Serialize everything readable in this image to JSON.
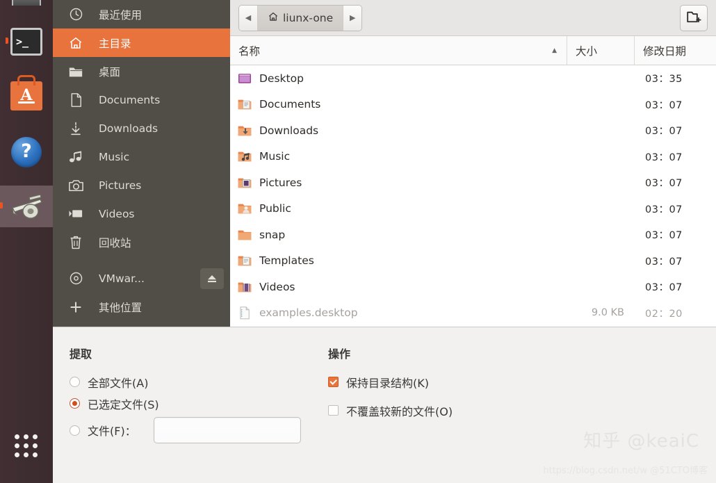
{
  "dock": {
    "items": [
      {
        "name": "partial-window-icon",
        "label": ""
      },
      {
        "name": "terminal",
        "label": "Terminal",
        "glyph": ">_",
        "running": true
      },
      {
        "name": "ubuntu-software",
        "label": "Ubuntu Software",
        "glyph": "A",
        "running": false
      },
      {
        "name": "help",
        "label": "Help",
        "glyph": "?",
        "running": false
      },
      {
        "name": "archive-manager",
        "label": "Archive Manager",
        "glyph": "",
        "running": true,
        "active": true
      },
      {
        "name": "show-applications",
        "label": "Show Applications",
        "glyph": "",
        "running": false
      }
    ]
  },
  "sidebar": {
    "items": [
      {
        "label": "最近使用",
        "icon": "clock-icon",
        "selected": false,
        "eject": false
      },
      {
        "label": "主目录",
        "icon": "home-icon",
        "selected": true,
        "eject": false
      },
      {
        "label": "桌面",
        "icon": "folder-icon",
        "selected": false,
        "eject": false
      },
      {
        "label": "Documents",
        "icon": "document-icon",
        "selected": false,
        "eject": false
      },
      {
        "label": "Downloads",
        "icon": "download-icon",
        "selected": false,
        "eject": false
      },
      {
        "label": "Music",
        "icon": "music-icon",
        "selected": false,
        "eject": false
      },
      {
        "label": "Pictures",
        "icon": "camera-icon",
        "selected": false,
        "eject": false
      },
      {
        "label": "Videos",
        "icon": "video-icon",
        "selected": false,
        "eject": false
      },
      {
        "label": "回收站",
        "icon": "trash-icon",
        "selected": false,
        "eject": false
      },
      {
        "label": "VMwar...",
        "icon": "disc-icon",
        "selected": false,
        "eject": true
      },
      {
        "label": "其他位置",
        "icon": "plus-icon",
        "selected": false,
        "eject": false
      }
    ]
  },
  "pathbar": {
    "back_label": "◀",
    "forward_label": "▶",
    "crumb_label": "liunx-one",
    "crumb_icon": "home-icon",
    "new_folder_icon": "new-folder-icon"
  },
  "filelist": {
    "columns": [
      {
        "key": "name",
        "label": "名称",
        "sorted": true,
        "sort_dir": "asc"
      },
      {
        "key": "size",
        "label": "大小",
        "sorted": false
      },
      {
        "key": "date",
        "label": "修改日期",
        "sorted": false
      }
    ],
    "sort_caret": "▲",
    "rows": [
      {
        "name": "Desktop",
        "size": "",
        "date": "03：35",
        "icon": "folder-desktop-icon",
        "dimmed": false
      },
      {
        "name": "Documents",
        "size": "",
        "date": "03：07",
        "icon": "folder-documents-icon",
        "dimmed": false
      },
      {
        "name": "Downloads",
        "size": "",
        "date": "03：07",
        "icon": "folder-downloads-icon",
        "dimmed": false
      },
      {
        "name": "Music",
        "size": "",
        "date": "03：07",
        "icon": "folder-music-icon",
        "dimmed": false
      },
      {
        "name": "Pictures",
        "size": "",
        "date": "03：07",
        "icon": "folder-pictures-icon",
        "dimmed": false
      },
      {
        "name": "Public",
        "size": "",
        "date": "03：07",
        "icon": "folder-public-icon",
        "dimmed": false
      },
      {
        "name": "snap",
        "size": "",
        "date": "03：07",
        "icon": "folder-icon",
        "dimmed": false
      },
      {
        "name": "Templates",
        "size": "",
        "date": "03：07",
        "icon": "folder-templates-icon",
        "dimmed": false
      },
      {
        "name": "Videos",
        "size": "",
        "date": "03：07",
        "icon": "folder-videos-icon",
        "dimmed": false
      },
      {
        "name": "examples.desktop",
        "size": "9.0 KB",
        "date": "02：20",
        "icon": "text-file-icon",
        "dimmed": true
      }
    ]
  },
  "dialog": {
    "extract": {
      "title": "提取",
      "options": [
        {
          "label": "全部文件(A)",
          "checked": false
        },
        {
          "label": "已选定文件(S)",
          "checked": true
        },
        {
          "label": "文件(F)：",
          "checked": false
        }
      ],
      "file_input_value": "",
      "file_input_placeholder": ""
    },
    "actions": {
      "title": "操作",
      "options": [
        {
          "label": "保持目录结构(K)",
          "checked": true
        },
        {
          "label": "不覆盖较新的文件(O)",
          "checked": false
        }
      ]
    }
  },
  "watermarks": {
    "zhihu": "知乎 @keaiC",
    "csdn": "https://blog.csdn.net/w @51CTO博客"
  },
  "colors": {
    "accent": "#e8733d",
    "sidebar_bg": "#504e47",
    "dock_bg": "#3b2b2e",
    "dialog_bg": "#f2f1f0",
    "radio_selected": "#d04f18"
  }
}
